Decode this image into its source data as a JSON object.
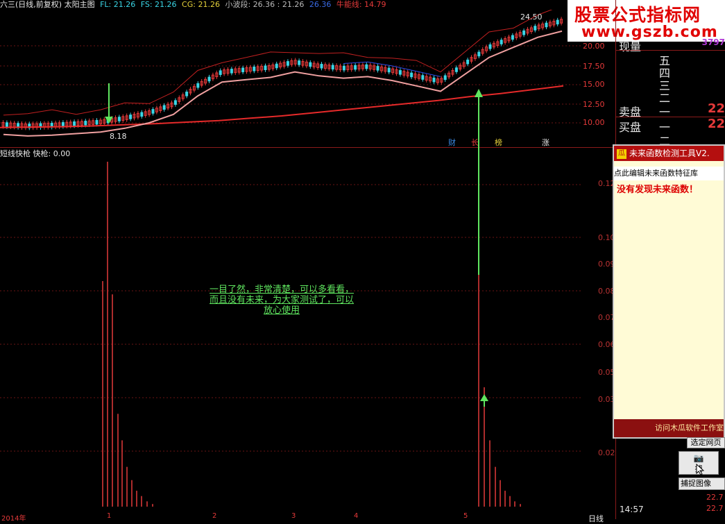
{
  "header": {
    "title": "六三(日线,前复权) 太阳主图",
    "fl": "FL: 21.26",
    "fs": "FS: 21.26",
    "cg": "CG: 21.26",
    "xiaobo": "小波段: 26.36 : 21.26",
    "xiaobo_extra": "26.36",
    "niuneng": "牛能线: 14.79"
  },
  "logo": {
    "line1": "股票公式指标网",
    "line2": "www.gszb.com"
  },
  "main_chart": {
    "price_high_label": "24.50",
    "price_low_label": "8.18",
    "y_ticks": [
      "20.00",
      "17.50",
      "15.00",
      "12.50",
      "10.00"
    ],
    "tags": [
      "财",
      "长",
      "榜",
      "涨"
    ]
  },
  "sub_chart": {
    "label": "短线快枪  快枪: 0.00",
    "y_ticks": [
      "0.12",
      "0.10",
      "0.09",
      "0.08",
      "0.07",
      "0.06",
      "0.05",
      "0.03",
      "0.02"
    ],
    "x_ticks": [
      "2014年",
      "1",
      "2",
      "3",
      "4",
      "5"
    ]
  },
  "note": {
    "text": "一目了然，非常清楚，可以多看看，而且没有未来，为大家测试了，可以放心使用"
  },
  "quote": {
    "volume_label": "现量",
    "volume_value": "3797",
    "sell_levels": [
      "五",
      "四",
      "三",
      "二"
    ],
    "sell_label": "卖盘",
    "sell_1": "一",
    "sell_value": "22",
    "buy_label": "买盘",
    "buy_1": "一",
    "buy_value": "22",
    "buy_2": "二"
  },
  "panel": {
    "title": "未来函数检测工具V2.",
    "icon_glyph": "瓜",
    "edit_link": "点此编辑未来函数特征库",
    "message": "没有发现未来函数！",
    "footer": "访问木瓜软件工作室"
  },
  "buttons": {
    "select_web": "选定网页",
    "capture": "捕",
    "capture_image": "捕捉图像"
  },
  "status": {
    "time": "14:57",
    "price1": "22.7",
    "price2": "22.7",
    "day_label": "日线"
  },
  "colors": {
    "up": "#e63a3a",
    "down": "#3ad6e6",
    "ma_red": "#e62a2a",
    "arrow": "#5fe65f",
    "panel_red": "#b40f0f"
  },
  "chart_data": [
    {
      "type": "line",
      "title": "太阳主图",
      "ylim": [
        7.5,
        25
      ],
      "series": [
        {
          "name": "牛能线",
          "values": [
            9.4,
            9.45,
            9.5,
            9.6,
            9.75,
            9.9,
            10.1,
            10.3,
            10.6,
            10.9,
            11.3,
            11.7,
            12.1,
            12.5,
            12.9,
            13.4,
            13.8,
            14.3,
            14.79
          ]
        }
      ]
    },
    {
      "type": "bar",
      "title": "短线快枪",
      "ylim": [
        0,
        0.14
      ],
      "spikes": [
        {
          "x": 155,
          "value": 0.13
        },
        {
          "x": 148,
          "value": 0.085
        },
        {
          "x": 162,
          "value": 0.08
        },
        {
          "x": 690,
          "value": 0.09
        },
        {
          "x": 698,
          "value": 0.045
        },
        {
          "x": 706,
          "value": 0.025
        }
      ]
    }
  ]
}
